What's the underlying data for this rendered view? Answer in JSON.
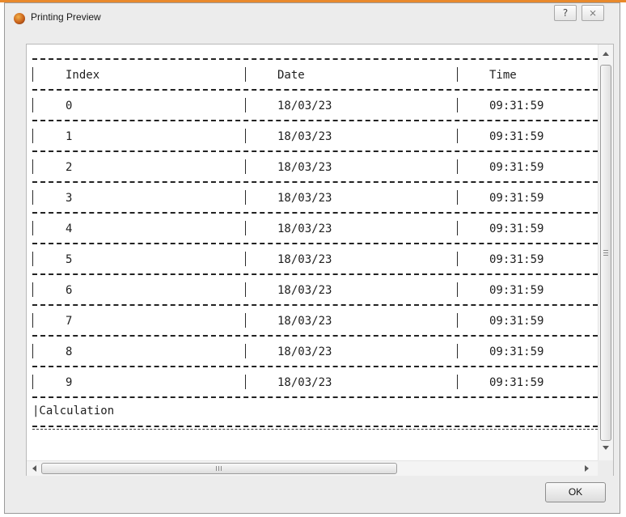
{
  "window": {
    "title": "Printing Preview",
    "help_label": "?",
    "close_label": "⨯",
    "accent_color": "#e8892c"
  },
  "table": {
    "headers": [
      "Index",
      "Date",
      "Time"
    ],
    "rows": [
      [
        "0",
        "18/03/23",
        "09:31:59"
      ],
      [
        "1",
        "18/03/23",
        "09:31:59"
      ],
      [
        "2",
        "18/03/23",
        "09:31:59"
      ],
      [
        "3",
        "18/03/23",
        "09:31:59"
      ],
      [
        "4",
        "18/03/23",
        "09:31:59"
      ],
      [
        "5",
        "18/03/23",
        "09:31:59"
      ],
      [
        "6",
        "18/03/23",
        "09:31:59"
      ],
      [
        "7",
        "18/03/23",
        "09:31:59"
      ],
      [
        "8",
        "18/03/23",
        "09:31:59"
      ],
      [
        "9",
        "18/03/23",
        "09:31:59"
      ]
    ],
    "footer": "|Calculation"
  },
  "buttons": {
    "ok": "OK"
  }
}
